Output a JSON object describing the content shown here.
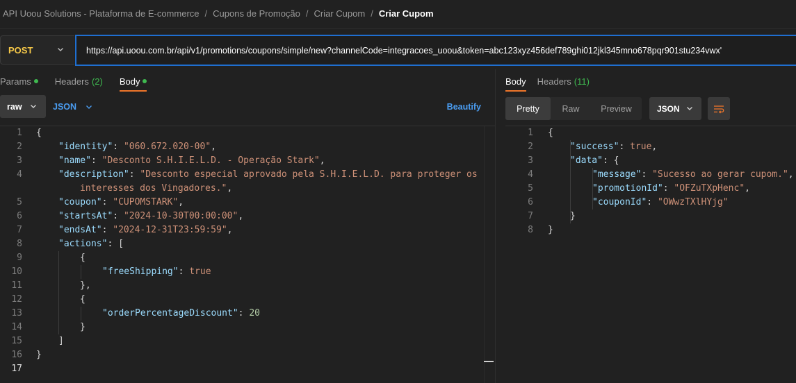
{
  "breadcrumb": {
    "items": [
      "API Uoou Solutions - Plataforma de E-commerce",
      "Cupons de Promoção",
      "Criar Cupom"
    ],
    "current": "Criar Cupom",
    "separator": "/"
  },
  "request": {
    "method": "POST",
    "url": "https://api.uoou.com.br/api/v1/promotions/coupons/simple/new?channelCode=integracoes_uoou&token=abc123xyz456def789ghi012jkl345mno678pqr901stu234vwx'"
  },
  "request_tabs": {
    "params": "Params",
    "headers": "Headers",
    "headers_count": "(2)",
    "body": "Body"
  },
  "body_options": {
    "mode": "raw",
    "language": "JSON",
    "beautify": "Beautify"
  },
  "request_body_lines": [
    "1",
    "2",
    "3",
    "4",
    "5",
    "6",
    "7",
    "8",
    "9",
    "10",
    "11",
    "12",
    "13",
    "14",
    "15",
    "16",
    "17"
  ],
  "request_body": {
    "identity_key": "\"identity\"",
    "identity_val": "\"060.672.020-00\"",
    "name_key": "\"name\"",
    "name_val": "\"Desconto S.H.I.E.L.D. - Operação Stark\"",
    "description_key": "\"description\"",
    "description_val_1": "\"Desconto especial aprovado pela S.H.I.E.L.D. para proteger os",
    "description_val_2": "interesses dos Vingadores.\"",
    "coupon_key": "\"coupon\"",
    "coupon_val": "\"CUPOMSTARK\"",
    "startsAt_key": "\"startsAt\"",
    "startsAt_val": "\"2024-10-30T00:00:00\"",
    "endsAt_key": "\"endsAt\"",
    "endsAt_val": "\"2024-12-31T23:59:59\"",
    "actions_key": "\"actions\"",
    "freeShipping_key": "\"freeShipping\"",
    "freeShipping_val": "true",
    "orderPercentageDiscount_key": "\"orderPercentageDiscount\"",
    "orderPercentageDiscount_val": "20"
  },
  "response_tabs": {
    "body": "Body",
    "headers": "Headers",
    "headers_count": "(11)"
  },
  "response_options": {
    "views": [
      "Pretty",
      "Raw",
      "Preview"
    ],
    "active_view": "Pretty",
    "language": "JSON"
  },
  "response_body_lines": [
    "1",
    "2",
    "3",
    "4",
    "5",
    "6",
    "7",
    "8"
  ],
  "response_body": {
    "success_key": "\"success\"",
    "success_val": "true",
    "data_key": "\"data\"",
    "message_key": "\"message\"",
    "message_val": "\"Sucesso ao gerar cupom.\"",
    "promotionId_key": "\"promotionId\"",
    "promotionId_val": "\"OFZuTXpHenc\"",
    "couponId_key": "\"couponId\"",
    "couponId_val": "\"OWwzTXlHYjg\""
  },
  "colors": {
    "method": "#f7c948",
    "accent_blue": "#4a9cf0",
    "active_tab_underline": "#f0762a",
    "dot_green": "#3fb950",
    "url_border": "#1f6fd1"
  },
  "icons": [
    "chevron-down-icon",
    "wrap-lines-icon"
  ]
}
